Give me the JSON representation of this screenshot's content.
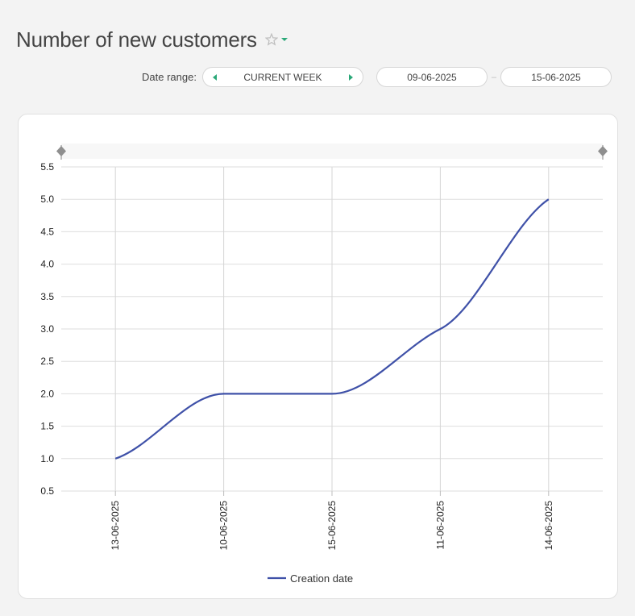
{
  "header": {
    "title": "Number of new customers"
  },
  "filters": {
    "date_range_label": "Date range:",
    "range_value": "CURRENT WEEK",
    "start_date": "09-06-2025",
    "end_date": "15-06-2025",
    "separator": "–"
  },
  "icons": {
    "favorite": "star-icon",
    "dropdown": "caret-down-icon",
    "prev": "arrow-left-icon",
    "next": "arrow-right-icon"
  },
  "colors": {
    "accent": "#2aa878",
    "series": "#3f51a8"
  },
  "chart_data": {
    "type": "line",
    "categories": [
      "13-06-2025",
      "10-06-2025",
      "15-06-2025",
      "11-06-2025",
      "14-06-2025"
    ],
    "series": [
      {
        "name": "Creation date",
        "values": [
          1,
          2,
          2,
          3,
          5
        ],
        "color": "#3f51a8"
      }
    ],
    "title": "",
    "xlabel": "",
    "ylabel": "",
    "ylim": [
      0.5,
      5.5
    ],
    "yticks": [
      "0.5",
      "1.0",
      "1.5",
      "2.0",
      "2.5",
      "3.0",
      "3.5",
      "4.0",
      "4.5",
      "5.0",
      "5.5"
    ],
    "grid": true,
    "legend": "bottom",
    "curve": "smooth"
  }
}
